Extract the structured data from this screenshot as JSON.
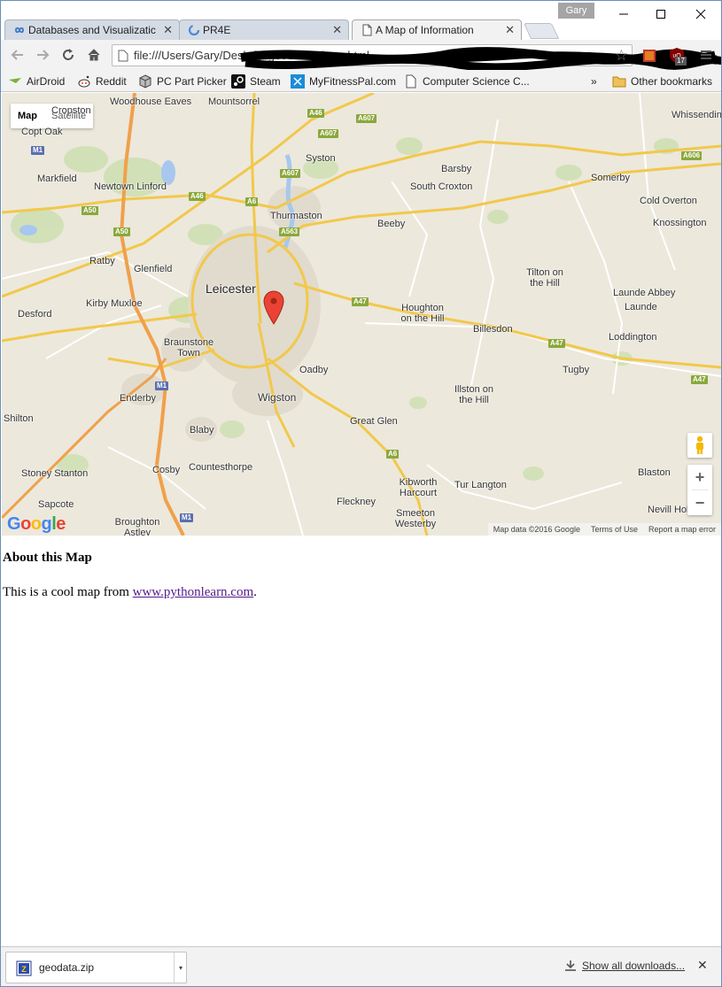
{
  "window": {
    "profile_name": "Gary",
    "minimize": "—",
    "maximize": "☐",
    "close": "✕"
  },
  "tabs": [
    {
      "title": "Databases and Visualizatic",
      "close": "✕"
    },
    {
      "title": "PR4E",
      "close": "✕"
    },
    {
      "title": "A Map of Information",
      "close": "✕"
    }
  ],
  "toolbar": {
    "back": "←",
    "forward": "→",
    "reload": "↻",
    "home": "⌂",
    "url": "file:///Users/Gary/Desktop/geodata/where.html",
    "star": "☆",
    "menu": "≡",
    "extension_badge": "17"
  },
  "bookmarks": [
    {
      "label": "AirDroid"
    },
    {
      "label": "Reddit"
    },
    {
      "label": "PC Part Picker"
    },
    {
      "label": "Steam"
    },
    {
      "label": "MyFitnessPal.com"
    },
    {
      "label": "Computer Science C..."
    }
  ],
  "bookmarks_overflow": "»",
  "other_bookmarks": "Other bookmarks",
  "map": {
    "type_map": "Map",
    "type_satellite": "Satellite",
    "places": [
      "Cropston",
      "Woodhouse Eaves",
      "Mountsorrel",
      "Whissendine",
      "Copt Oak",
      "Syston",
      "Barsby",
      "Markfield",
      "Newtown Linford",
      "South Croxton",
      "Somerby",
      "Thurmaston",
      "Cold Overton",
      "Beeby",
      "Knossington",
      "Ratby",
      "Glenfield",
      "Leicester",
      "Tilton on the Hill",
      "Launde Abbey",
      "Launde",
      "Desford",
      "Kirby Muxloe",
      "Houghton on the Hill",
      "Billesdon",
      "Braunstone Town",
      "Loddington",
      "Oadby",
      "Tugby",
      "Enderby",
      "Wigston",
      "Illston on the Hill",
      "Shilton",
      "Great Glen",
      "Blaby",
      "Countesthorpe",
      "Stoney Stanton",
      "Cosby",
      "Kibworth Harcourt",
      "Tur Langton",
      "Blaston",
      "Sapcote",
      "Fleckney",
      "Nevill Holt",
      "Broughton Astley",
      "Smeeton Westerby"
    ],
    "roads": [
      "A46",
      "A607",
      "A607",
      "M1",
      "A606",
      "A50",
      "A46",
      "A6",
      "A607",
      "A563",
      "A50",
      "A47",
      "A47",
      "M1",
      "A47",
      "A6",
      "M1"
    ],
    "zoom_in": "+",
    "zoom_out": "−",
    "google_logo": "Google",
    "attribution": "Map data ©2016 Google",
    "terms": "Terms of Use",
    "report": "Report a map error"
  },
  "content": {
    "heading": "About this Map",
    "text_before": "This is a cool map from ",
    "link": "www.pythonlearn.com",
    "text_after": "."
  },
  "downloads": {
    "file": "geodata.zip",
    "dropdown": "▾",
    "show_all": "Show all downloads...",
    "close": "✕"
  }
}
